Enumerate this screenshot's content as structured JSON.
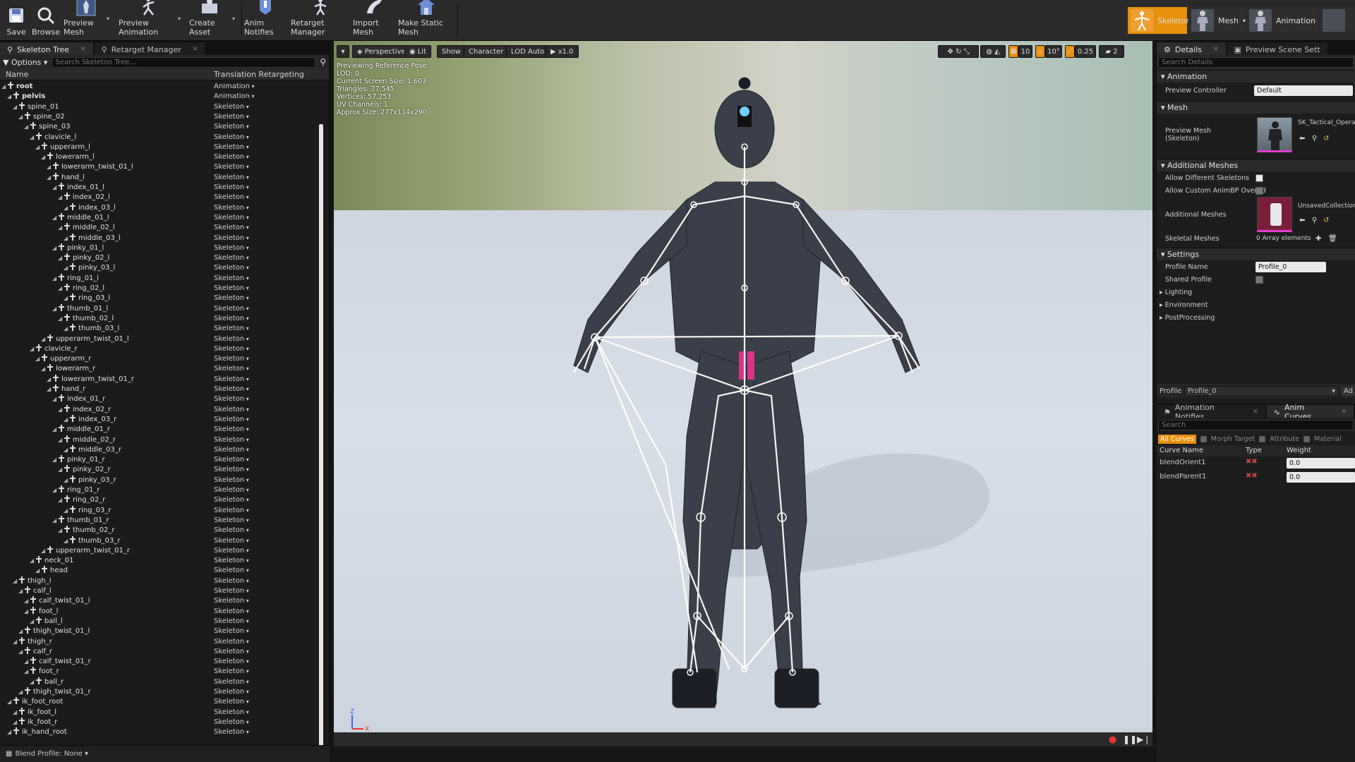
{
  "toolbar": {
    "buttons": [
      {
        "label": "Save",
        "icon": "save-icon"
      },
      {
        "label": "Browse",
        "icon": "browse-icon"
      },
      {
        "label": "Preview Mesh",
        "icon": "preview-mesh-icon"
      },
      {
        "label": "Preview Animation",
        "icon": "preview-animation-icon"
      },
      {
        "label": "Create Asset",
        "icon": "create-asset-icon"
      },
      {
        "label": "Anim Notifies",
        "icon": "anim-notifies-icon"
      },
      {
        "label": "Retarget Manager",
        "icon": "retarget-manager-icon"
      },
      {
        "label": "Import Mesh",
        "icon": "import-mesh-icon"
      },
      {
        "label": "Make Static Mesh",
        "icon": "make-static-mesh-icon"
      }
    ],
    "modes": [
      {
        "label": "Skeleton",
        "active": true
      },
      {
        "label": "Mesh",
        "active": false
      },
      {
        "label": "Animation",
        "active": false
      }
    ],
    "accent": "#e8900c"
  },
  "left": {
    "tabs": [
      {
        "label": "Skeleton Tree"
      },
      {
        "label": "Retarget Manager"
      }
    ],
    "options_label": "Options",
    "search_placeholder": "Search Skeleton Tree...",
    "col_name": "Name",
    "col_retarget": "Translation Retargeting",
    "blend_profile": "Blend Profile: None",
    "bones": [
      {
        "n": "root",
        "d": 0,
        "t": "Animation",
        "b": true
      },
      {
        "n": "pelvis",
        "d": 1,
        "t": "Animation",
        "b": true
      },
      {
        "n": "spine_01",
        "d": 2,
        "t": "Skeleton",
        "b": false
      },
      {
        "n": "spine_02",
        "d": 3,
        "t": "Skeleton",
        "b": false
      },
      {
        "n": "spine_03",
        "d": 4,
        "t": "Skeleton",
        "b": false
      },
      {
        "n": "clavicle_l",
        "d": 5,
        "t": "Skeleton",
        "b": false
      },
      {
        "n": "upperarm_l",
        "d": 6,
        "t": "Skeleton",
        "b": false
      },
      {
        "n": "lowerarm_l",
        "d": 7,
        "t": "Skeleton",
        "b": false
      },
      {
        "n": "lowerarm_twist_01_l",
        "d": 8,
        "t": "Skeleton",
        "b": false
      },
      {
        "n": "hand_l",
        "d": 8,
        "t": "Skeleton",
        "b": false
      },
      {
        "n": "index_01_l",
        "d": 9,
        "t": "Skeleton",
        "b": false
      },
      {
        "n": "index_02_l",
        "d": 10,
        "t": "Skeleton",
        "b": false
      },
      {
        "n": "index_03_l",
        "d": 11,
        "t": "Skeleton",
        "b": false
      },
      {
        "n": "middle_01_l",
        "d": 9,
        "t": "Skeleton",
        "b": false
      },
      {
        "n": "middle_02_l",
        "d": 10,
        "t": "Skeleton",
        "b": false
      },
      {
        "n": "middle_03_l",
        "d": 11,
        "t": "Skeleton",
        "b": false
      },
      {
        "n": "pinky_01_l",
        "d": 9,
        "t": "Skeleton",
        "b": false
      },
      {
        "n": "pinky_02_l",
        "d": 10,
        "t": "Skeleton",
        "b": false
      },
      {
        "n": "pinky_03_l",
        "d": 11,
        "t": "Skeleton",
        "b": false
      },
      {
        "n": "ring_01_l",
        "d": 9,
        "t": "Skeleton",
        "b": false
      },
      {
        "n": "ring_02_l",
        "d": 10,
        "t": "Skeleton",
        "b": false
      },
      {
        "n": "ring_03_l",
        "d": 11,
        "t": "Skeleton",
        "b": false
      },
      {
        "n": "thumb_01_l",
        "d": 9,
        "t": "Skeleton",
        "b": false
      },
      {
        "n": "thumb_02_l",
        "d": 10,
        "t": "Skeleton",
        "b": false
      },
      {
        "n": "thumb_03_l",
        "d": 11,
        "t": "Skeleton",
        "b": false
      },
      {
        "n": "upperarm_twist_01_l",
        "d": 7,
        "t": "Skeleton",
        "b": false
      },
      {
        "n": "clavicle_r",
        "d": 5,
        "t": "Skeleton",
        "b": false
      },
      {
        "n": "upperarm_r",
        "d": 6,
        "t": "Skeleton",
        "b": false
      },
      {
        "n": "lowerarm_r",
        "d": 7,
        "t": "Skeleton",
        "b": false
      },
      {
        "n": "lowerarm_twist_01_r",
        "d": 8,
        "t": "Skeleton",
        "b": false
      },
      {
        "n": "hand_r",
        "d": 8,
        "t": "Skeleton",
        "b": false
      },
      {
        "n": "index_01_r",
        "d": 9,
        "t": "Skeleton",
        "b": false
      },
      {
        "n": "index_02_r",
        "d": 10,
        "t": "Skeleton",
        "b": false
      },
      {
        "n": "index_03_r",
        "d": 11,
        "t": "Skeleton",
        "b": false
      },
      {
        "n": "middle_01_r",
        "d": 9,
        "t": "Skeleton",
        "b": false
      },
      {
        "n": "middle_02_r",
        "d": 10,
        "t": "Skeleton",
        "b": false
      },
      {
        "n": "middle_03_r",
        "d": 11,
        "t": "Skeleton",
        "b": false
      },
      {
        "n": "pinky_01_r",
        "d": 9,
        "t": "Skeleton",
        "b": false
      },
      {
        "n": "pinky_02_r",
        "d": 10,
        "t": "Skeleton",
        "b": false
      },
      {
        "n": "pinky_03_r",
        "d": 11,
        "t": "Skeleton",
        "b": false
      },
      {
        "n": "ring_01_r",
        "d": 9,
        "t": "Skeleton",
        "b": false
      },
      {
        "n": "ring_02_r",
        "d": 10,
        "t": "Skeleton",
        "b": false
      },
      {
        "n": "ring_03_r",
        "d": 11,
        "t": "Skeleton",
        "b": false
      },
      {
        "n": "thumb_01_r",
        "d": 9,
        "t": "Skeleton",
        "b": false
      },
      {
        "n": "thumb_02_r",
        "d": 10,
        "t": "Skeleton",
        "b": false
      },
      {
        "n": "thumb_03_r",
        "d": 11,
        "t": "Skeleton",
        "b": false
      },
      {
        "n": "upperarm_twist_01_r",
        "d": 7,
        "t": "Skeleton",
        "b": false
      },
      {
        "n": "neck_01",
        "d": 5,
        "t": "Skeleton",
        "b": false
      },
      {
        "n": "head",
        "d": 6,
        "t": "Skeleton",
        "b": false
      },
      {
        "n": "thigh_l",
        "d": 2,
        "t": "Skeleton",
        "b": false
      },
      {
        "n": "calf_l",
        "d": 3,
        "t": "Skeleton",
        "b": false
      },
      {
        "n": "calf_twist_01_l",
        "d": 4,
        "t": "Skeleton",
        "b": false
      },
      {
        "n": "foot_l",
        "d": 4,
        "t": "Skeleton",
        "b": false
      },
      {
        "n": "ball_l",
        "d": 5,
        "t": "Skeleton",
        "b": false
      },
      {
        "n": "thigh_twist_01_l",
        "d": 3,
        "t": "Skeleton",
        "b": false
      },
      {
        "n": "thigh_r",
        "d": 2,
        "t": "Skeleton",
        "b": false
      },
      {
        "n": "calf_r",
        "d": 3,
        "t": "Skeleton",
        "b": false
      },
      {
        "n": "calf_twist_01_r",
        "d": 4,
        "t": "Skeleton",
        "b": false
      },
      {
        "n": "foot_r",
        "d": 4,
        "t": "Skeleton",
        "b": false
      },
      {
        "n": "ball_r",
        "d": 5,
        "t": "Skeleton",
        "b": false
      },
      {
        "n": "thigh_twist_01_r",
        "d": 3,
        "t": "Skeleton",
        "b": false
      },
      {
        "n": "ik_foot_root",
        "d": 1,
        "t": "Skeleton",
        "b": false
      },
      {
        "n": "ik_foot_l",
        "d": 2,
        "t": "Skeleton",
        "b": false
      },
      {
        "n": "ik_foot_r",
        "d": 2,
        "t": "Skeleton",
        "b": false
      },
      {
        "n": "ik_hand_root",
        "d": 1,
        "t": "Skeleton",
        "b": false
      }
    ]
  },
  "viewport": {
    "perspective": "Perspective",
    "lit": "Lit",
    "show": "Show",
    "character": "Character",
    "lod": "LOD Auto",
    "speed": "x1.0",
    "stats": [
      "Previewing Reference Pose",
      "LOD: 0",
      "Current Screen Size: 1.603",
      "Triangles: 77,545",
      "Vertices: 57,253",
      "UV Channels: 1",
      "Approx Size: 277x114x290"
    ],
    "grid_snap": "10",
    "rot_snap": "10°",
    "scale_snap": "0.25",
    "cam_speed": "2"
  },
  "right": {
    "tabs": [
      {
        "label": "Details"
      },
      {
        "label": "Preview Scene Sett"
      }
    ],
    "search_placeholder": "Search Details",
    "animation_section": "Animation",
    "preview_controller_label": "Preview Controller",
    "preview_controller_value": "Default",
    "mesh_section": "Mesh",
    "preview_mesh_label": "Preview Mesh (Skeleton)",
    "preview_mesh_value": "SK_Tactical_Operat",
    "additional_section": "Additional Meshes",
    "allow_diff_label": "Allow Different Skeletons",
    "allow_custom_label": "Allow Custom AnimBP Overrid",
    "additional_meshes_label": "Additional Meshes",
    "additional_meshes_value": "UnsavedCollection",
    "skeletal_meshes_label": "Skeletal Meshes",
    "skeletal_meshes_value": "0 Array elements",
    "settings_section": "Settings",
    "profile_name_label": "Profile Name",
    "profile_name_value": "Profile_0",
    "shared_profile_label": "Shared Profile",
    "lighting": "Lighting",
    "environment": "Environment",
    "postprocessing": "PostProcessing",
    "profile_label": "Profile",
    "profile_value": "Profile_0",
    "add_label": "Ad",
    "bottom_tabs": [
      {
        "label": "Animation Notifies"
      },
      {
        "label": "Anim Curves"
      }
    ],
    "curve_search": "Search",
    "filters": [
      {
        "label": "All Curves",
        "active": true
      },
      {
        "label": "Morph Target",
        "active": false
      },
      {
        "label": "Attribute",
        "active": false
      },
      {
        "label": "Material",
        "active": false
      }
    ],
    "curve_cols": [
      "Curve Name",
      "Type",
      "Weight"
    ],
    "curves": [
      {
        "name": "blendOrient1",
        "weight": "0.0"
      },
      {
        "name": "blendParent1",
        "weight": "0.0"
      }
    ]
  }
}
